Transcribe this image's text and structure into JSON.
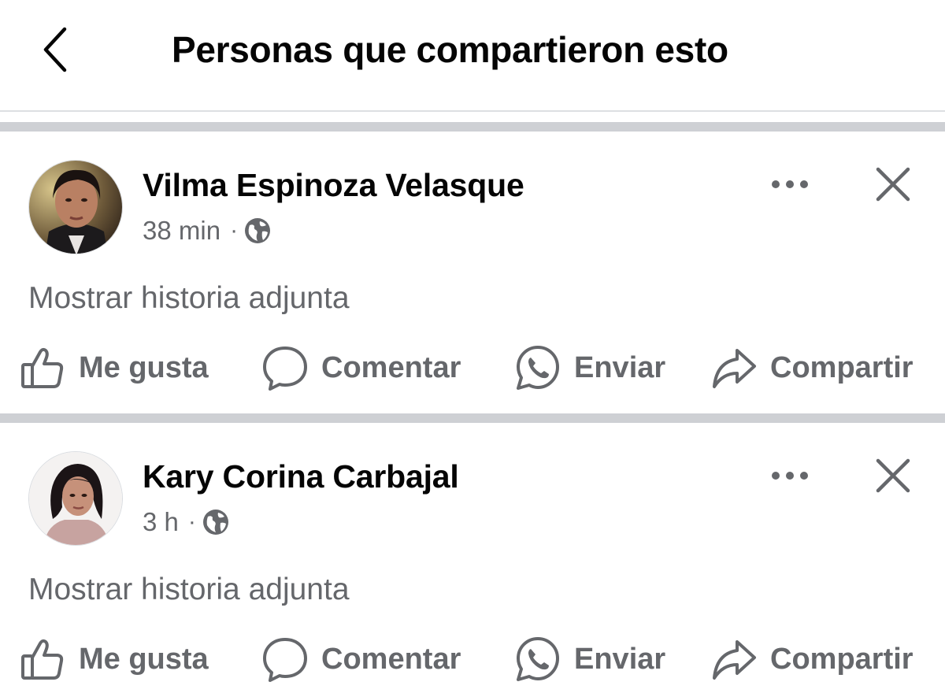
{
  "header": {
    "title": "Personas que compartieron esto",
    "back_icon": "chevron-left-icon"
  },
  "posts": [
    {
      "author": "Vilma Espinoza Velasque",
      "time": "38 min",
      "separator": "·",
      "privacy_icon": "globe-icon",
      "attached_story": "Mostrar historia adjunta",
      "actions": {
        "like": "Me gusta",
        "comment": "Comentar",
        "send": "Enviar",
        "share": "Compartir"
      }
    },
    {
      "author": "Kary Corina Carbajal",
      "time": "3 h",
      "separator": "·",
      "privacy_icon": "globe-icon",
      "attached_story": "Mostrar historia adjunta",
      "actions": {
        "like": "Me gusta",
        "comment": "Comentar",
        "send": "Enviar",
        "share": "Compartir"
      }
    }
  ],
  "colors": {
    "text_primary": "#050505",
    "text_secondary": "#65676b",
    "separator": "#ced0d4"
  }
}
